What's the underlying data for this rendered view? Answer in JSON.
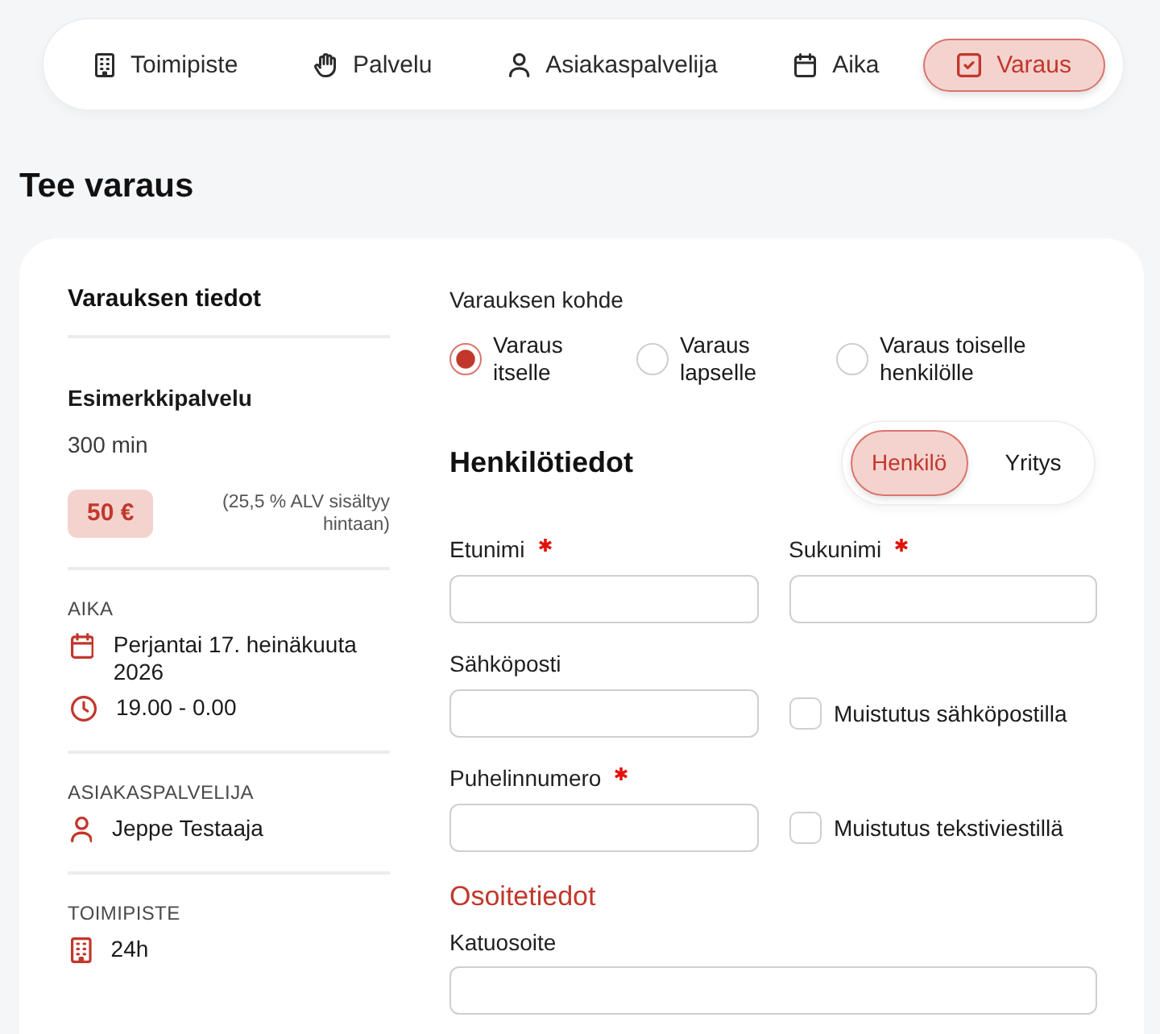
{
  "nav": {
    "items": [
      {
        "kind": "office",
        "label": "Toimipiste",
        "selected": false
      },
      {
        "kind": "service",
        "label": "Palvelu",
        "selected": false
      },
      {
        "kind": "staff",
        "label": "Asiakaspalvelija",
        "selected": false
      },
      {
        "kind": "time",
        "label": "Aika",
        "selected": false
      },
      {
        "kind": "booking",
        "label": "Varaus",
        "selected": true
      }
    ]
  },
  "page_title": "Tee varaus",
  "summary": {
    "title": "Varauksen tiedot",
    "service": "Esimerkkipalvelu",
    "duration": "300 min",
    "price": "50 €",
    "vat_note": "(25,5 % ALV sisältyy hintaan)",
    "sections": [
      {
        "heading": "AIKA",
        "lines": [
          {
            "kind": "date",
            "text": "Perjantai 17. heinäkuuta 2026"
          },
          {
            "kind": "time",
            "text": "19.00 - 0.00"
          }
        ]
      },
      {
        "heading": "ASIAKASPALVELIJA",
        "lines": [
          {
            "kind": "staff",
            "text": "Jeppe Testaaja"
          }
        ]
      },
      {
        "heading": "TOIMIPISTE",
        "lines": [
          {
            "kind": "office",
            "text": "24h"
          }
        ]
      }
    ]
  },
  "form": {
    "target_label": "Varauksen kohde",
    "targets": [
      {
        "label": "Varaus itselle",
        "selected": true
      },
      {
        "label": "Varaus lapselle",
        "selected": false
      },
      {
        "label": "Varaus toiselle henkilölle",
        "selected": false
      }
    ],
    "personal_heading": "Henkilötiedot",
    "customer_types": [
      {
        "label": "Henkilö",
        "selected": true
      },
      {
        "label": "Yritys",
        "selected": false
      }
    ],
    "fields": [
      {
        "kind": "text",
        "label": "Etunimi",
        "required": true
      },
      {
        "kind": "text",
        "label": "Sukunimi",
        "required": true
      },
      {
        "kind": "text",
        "label": "Sähköposti",
        "required": false
      },
      {
        "kind": "checkbox",
        "label": "Muistutus sähköpostilla",
        "checked": false
      },
      {
        "kind": "text",
        "label": "Puhelinnumero",
        "required": true
      },
      {
        "kind": "checkbox",
        "label": "Muistutus tekstiviestillä",
        "checked": false
      }
    ],
    "address_heading": "Osoitetiedot",
    "address_fields": [
      {
        "kind": "text",
        "label": "Katuosoite",
        "required": false
      }
    ]
  }
}
